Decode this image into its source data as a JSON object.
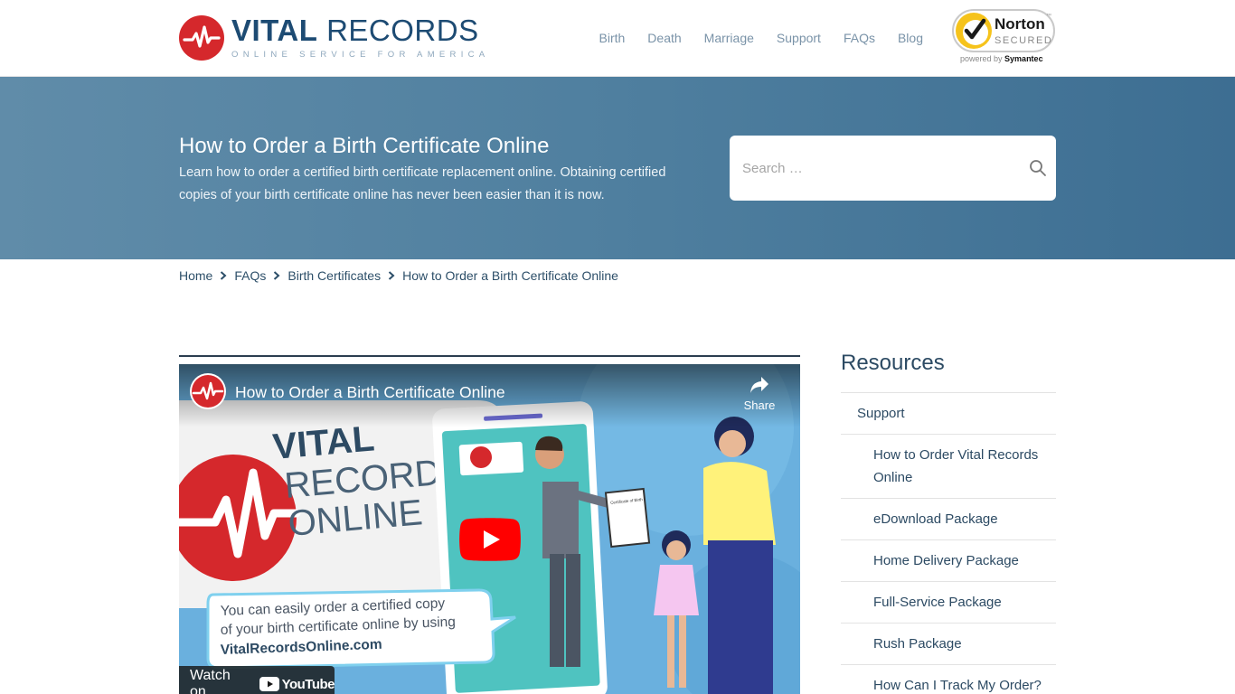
{
  "header": {
    "logo_bold": "VITAL",
    "logo_light": "RECORDS",
    "logo_tagline": "ONLINE SERVICE FOR AMERICA",
    "nav": [
      {
        "label": "Birth"
      },
      {
        "label": "Death"
      },
      {
        "label": "Marriage"
      },
      {
        "label": "Support"
      },
      {
        "label": "FAQs"
      },
      {
        "label": "Blog"
      }
    ],
    "norton": {
      "name": "Norton",
      "secured": "SECURED",
      "tm": "™",
      "powered_prefix": "powered by",
      "powered_brand": "Symantec"
    }
  },
  "hero": {
    "title": "How to Order a Birth Certificate Online",
    "description": "Learn how to order a certified birth certificate replacement online. Obtaining certified copies of your birth certificate online has never been easier than it is now.",
    "search_placeholder": "Search …"
  },
  "breadcrumb": [
    {
      "label": "Home"
    },
    {
      "label": "FAQs"
    },
    {
      "label": "Birth Certificates"
    },
    {
      "label": "How to Order a Birth Certificate Online"
    }
  ],
  "video": {
    "title": "How to Order a Birth Certificate Online",
    "share_label": "Share",
    "watch_on_label": "Watch on",
    "youtube_label": "YouTube",
    "thumb_logo_line1": "VITAL",
    "thumb_logo_line2": "RECORDS",
    "thumb_logo_line3": "ONLINE",
    "thumb_bubble_line1": "You can easily order a certified copy",
    "thumb_bubble_line2": "of your birth certificate online by using",
    "thumb_bubble_line3": "VitalRecordsOnline.com",
    "thumb_certificate_title": "Certificate of Birth"
  },
  "sidebar": {
    "title": "Resources",
    "items": [
      {
        "label": "Support",
        "level": 1
      },
      {
        "label": "How to Order Vital Records Online",
        "level": 2
      },
      {
        "label": "eDownload Package",
        "level": 2
      },
      {
        "label": "Home Delivery Package",
        "level": 2
      },
      {
        "label": "Full-Service Package",
        "level": 2
      },
      {
        "label": "Rush Package",
        "level": 2
      },
      {
        "label": "How Can I Track My Order?",
        "level": 2
      }
    ]
  },
  "colors": {
    "brand_red": "#d5282c",
    "brand_navy": "#1d4b73",
    "hero_blue": "#4f7f9f",
    "youtube_red": "#ff0000"
  }
}
